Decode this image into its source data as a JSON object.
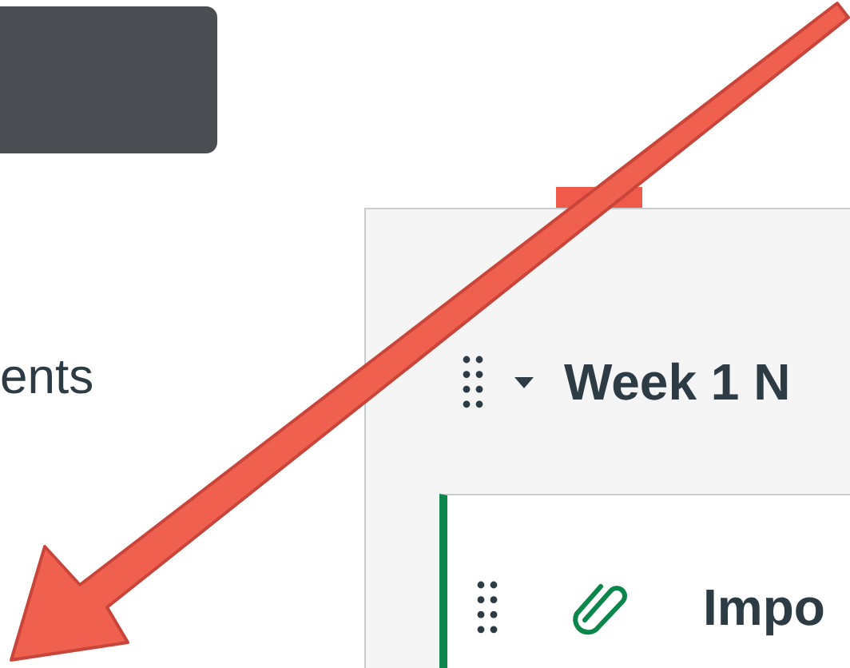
{
  "nav": {
    "item": "ents"
  },
  "module": {
    "title": "Week 1 N",
    "expanded": true,
    "items": [
      {
        "kind": "attachment",
        "title": "Impo"
      }
    ]
  }
}
